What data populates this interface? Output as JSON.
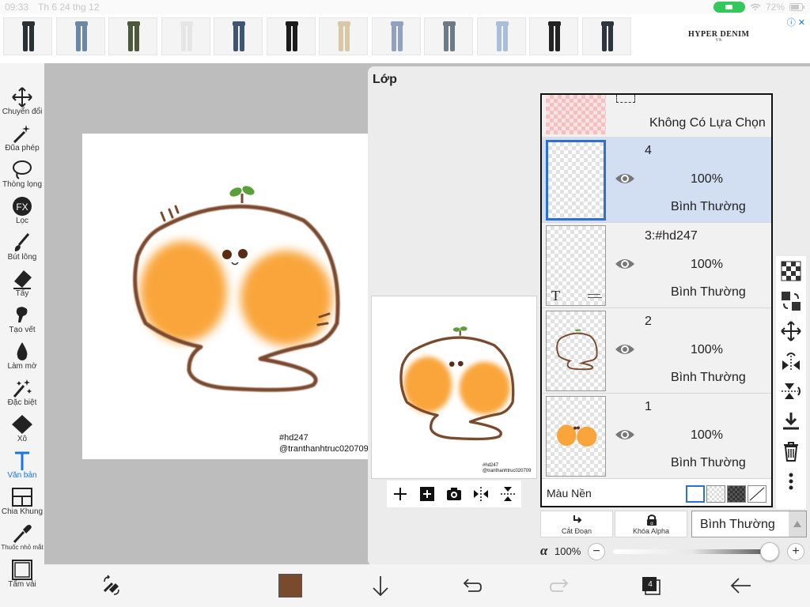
{
  "status_bar": {
    "time": "09:33",
    "date": "Th 6 24 thg 12",
    "battery": "72%"
  },
  "ad": {
    "brand": "HYPER DENIM",
    "brand_sub": "VN",
    "info_icon": "info-icon",
    "thumbnails": [
      {
        "color": "#2b2f36"
      },
      {
        "color": "#6b87a8"
      },
      {
        "color": "#4d5a3a"
      },
      {
        "color": "#e6e6e6"
      },
      {
        "color": "#3f5573"
      },
      {
        "color": "#1c1c1c"
      },
      {
        "color": "#d8c9a6"
      },
      {
        "color": "#8fa3c0"
      },
      {
        "color": "#6d7b86"
      },
      {
        "color": "#a9bed8"
      },
      {
        "color": "#222222"
      },
      {
        "color": "#2e3440"
      }
    ]
  },
  "tools": [
    {
      "label": "Chuyển đổi",
      "icon": "move-icon"
    },
    {
      "label": "Đũa phép",
      "icon": "magic-wand-icon"
    },
    {
      "label": "Thòng lọng",
      "icon": "lasso-icon"
    },
    {
      "label": "Lọc",
      "icon": "fx-icon"
    },
    {
      "label": "Bút lông",
      "icon": "brush-icon"
    },
    {
      "label": "Tẩy",
      "icon": "eraser-icon"
    },
    {
      "label": "Tạo vết",
      "icon": "smudge-icon"
    },
    {
      "label": "Làm mờ",
      "icon": "blur-icon"
    },
    {
      "label": "Đặc biệt",
      "icon": "special-icon"
    },
    {
      "label": "Xô",
      "icon": "bucket-icon"
    },
    {
      "label": "Văn bản",
      "icon": "text-icon",
      "active": true
    },
    {
      "label": "Chia Khung",
      "icon": "frame-divider-icon"
    },
    {
      "label": "Thuốc nhỏ mắt",
      "icon": "eyedropper-icon"
    },
    {
      "label": "Tấm vải",
      "icon": "canvas-icon"
    }
  ],
  "canvas": {
    "hashtag": "#hd247",
    "handle": "@tranthanhtruc020709"
  },
  "layers_panel": {
    "title": "Lớp",
    "selection_layer_label": "Không Có Lựa Chọn",
    "layers": [
      {
        "name": "4",
        "opacity": "100%",
        "blend": "Bình Thường",
        "selected": true
      },
      {
        "name": "3:#hd247",
        "opacity": "100%",
        "blend": "Bình Thường",
        "selected": false,
        "text_layer_glyph": "T"
      },
      {
        "name": "2",
        "opacity": "100%",
        "blend": "Bình Thường",
        "selected": false
      },
      {
        "name": "1",
        "opacity": "100%",
        "blend": "Bình Thường",
        "selected": false
      }
    ],
    "background_label": "Màu Nền",
    "cut_label": "Cắt Đoạn",
    "alpha_lock_label": "Khóa Alpha",
    "blend_mode": "Bình Thường",
    "alpha_symbol": "α",
    "alpha_value": "100%",
    "alpha_fraction": 1.0,
    "minus": "−",
    "plus": "+"
  },
  "bottom_bar": {
    "current_color": "#7a4a2e",
    "layer_count": "4"
  }
}
